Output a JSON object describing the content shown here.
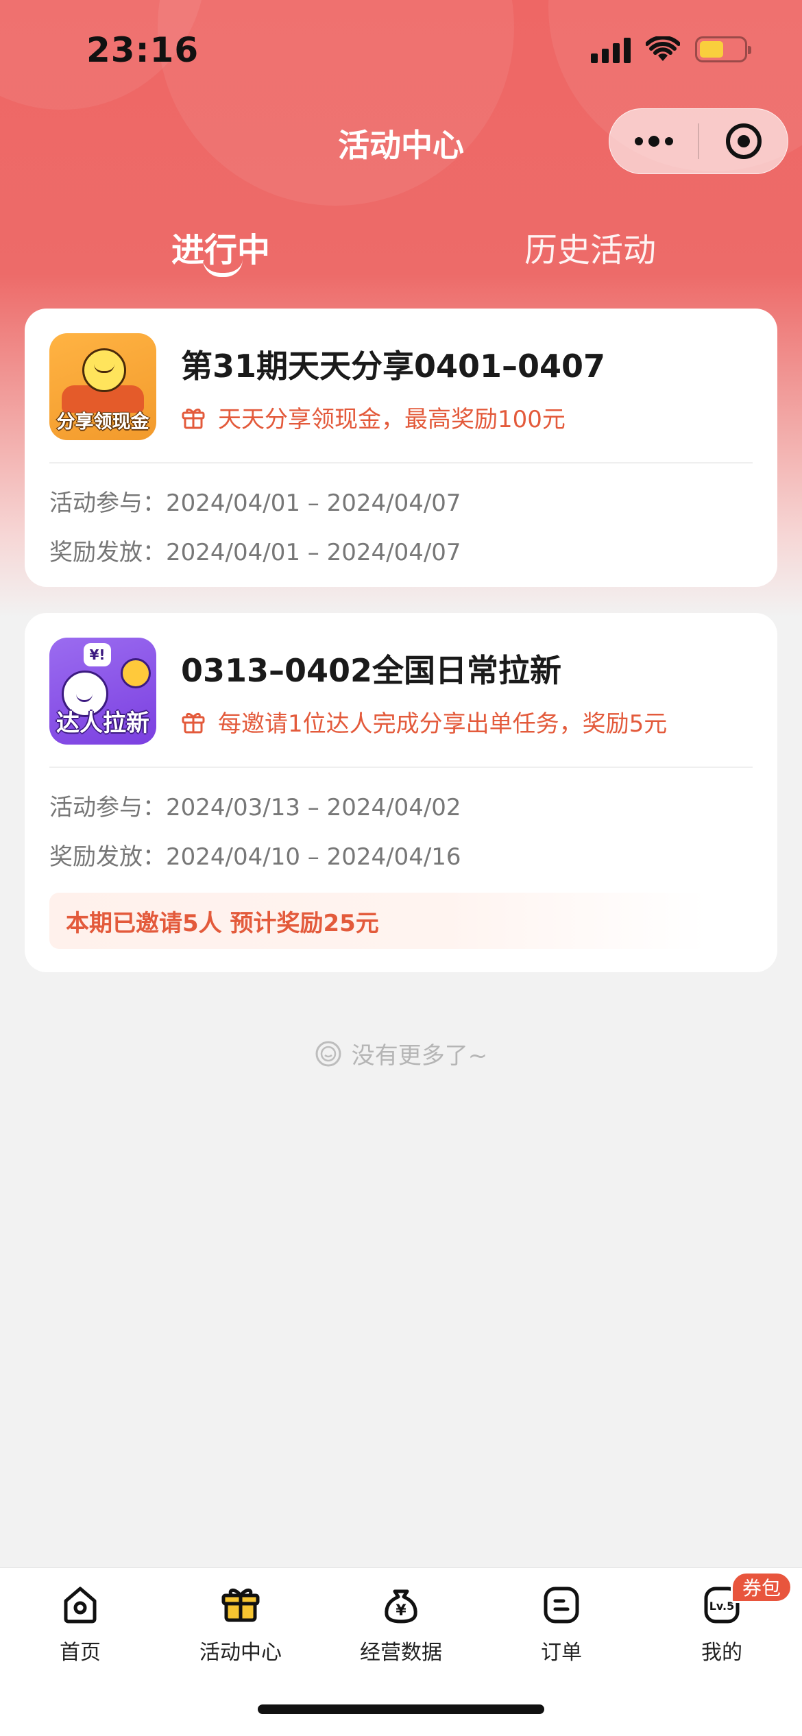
{
  "status_bar": {
    "time": "23:16"
  },
  "nav": {
    "title": "活动中心"
  },
  "tabs": {
    "active": "进行中",
    "inactive": "历史活动"
  },
  "cards": [
    {
      "icon_caption": "分享领现金",
      "title": "第31期天天分享0401–0407",
      "subtitle": "天天分享领现金，最高奖励100元",
      "participate_label": "活动参与：",
      "participate_value": "2024/04/01 – 2024/04/07",
      "reward_label": "奖励发放：",
      "reward_value": "2024/04/01 – 2024/04/07"
    },
    {
      "icon_caption": "达人拉新",
      "icon_bubble": "¥!",
      "title": "0313–0402全国日常拉新",
      "subtitle": "每邀请1位达人完成分享出单任务，奖励5元",
      "participate_label": "活动参与：",
      "participate_value": "2024/03/13 – 2024/04/02",
      "reward_label": "奖励发放：",
      "reward_value": "2024/04/10 – 2024/04/16",
      "invite_summary": "本期已邀请5人 预计奖励25元"
    }
  ],
  "footer_note": "没有更多了~",
  "tabbar": {
    "items": [
      {
        "label": "首页",
        "icon": "home-icon"
      },
      {
        "label": "活动中心",
        "icon": "gift-icon"
      },
      {
        "label": "经营数据",
        "icon": "money-bag-icon"
      },
      {
        "label": "订单",
        "icon": "order-icon"
      },
      {
        "label": "我的",
        "icon": "level-icon"
      }
    ],
    "badge": "券包",
    "level_text": "Lv.5"
  },
  "colors": {
    "header": "#ee6765",
    "accent": "#e35a3b",
    "active_tab_icon": "#f7c531"
  }
}
